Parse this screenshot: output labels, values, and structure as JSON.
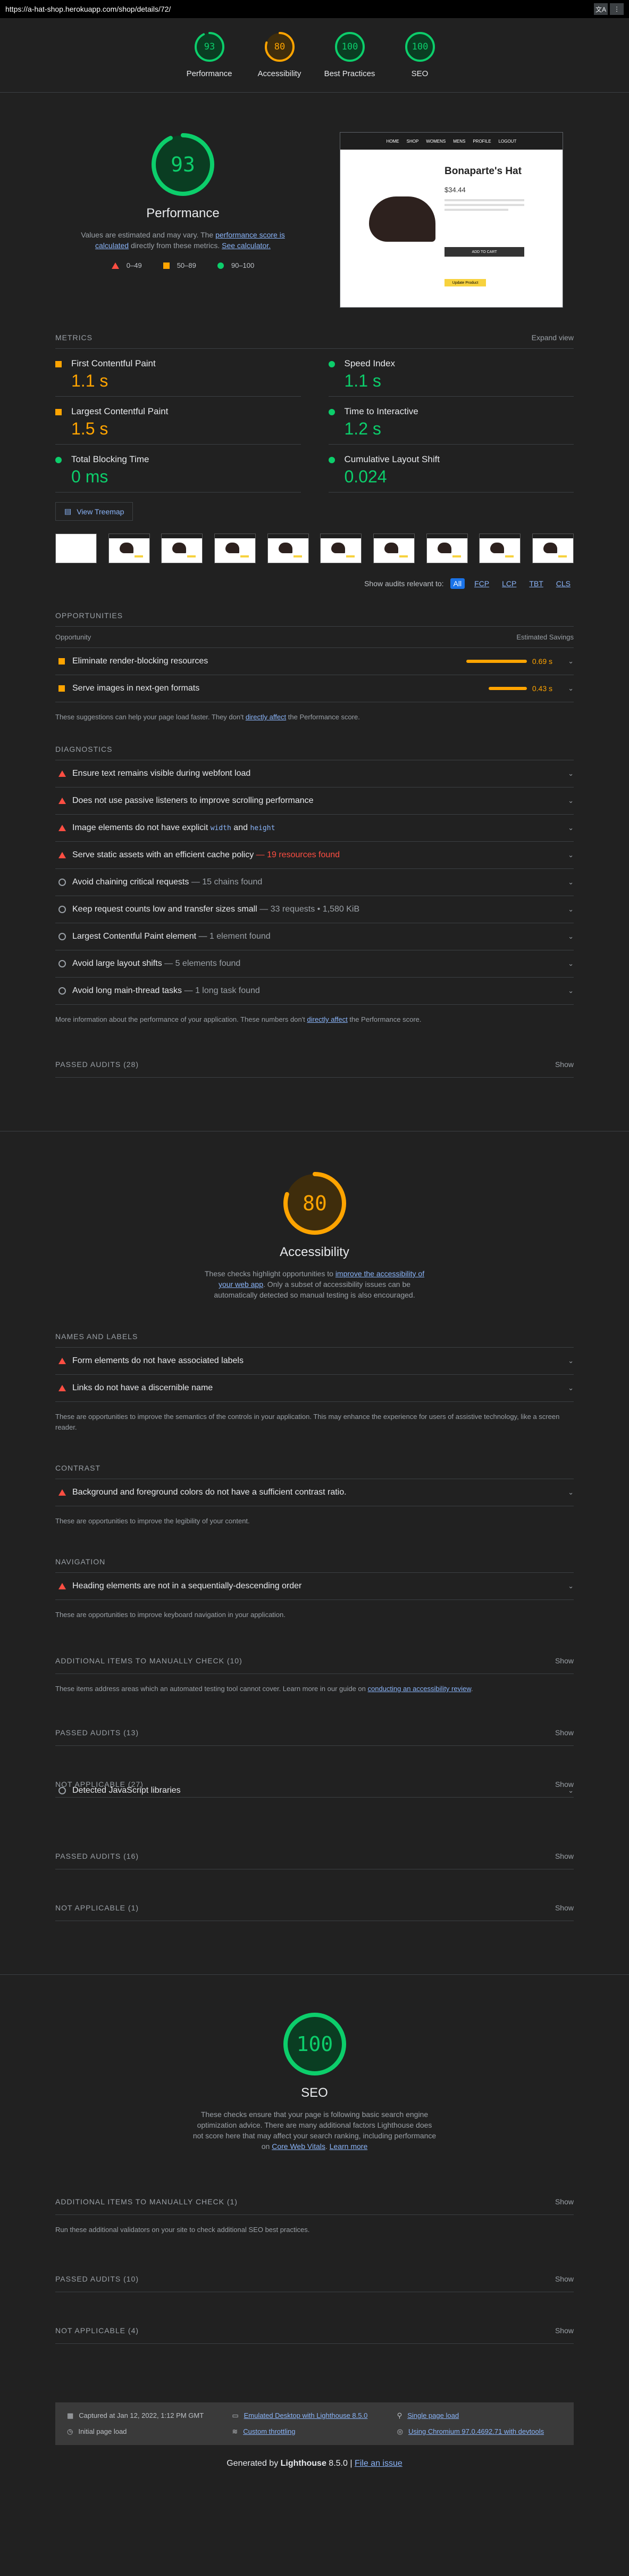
{
  "topbar": {
    "url": "https://a-hat-shop.herokuapp.com/shop/details/72/",
    "translate_icon": "translate-icon",
    "menu_icon": "kebab-icon"
  },
  "summary_gauges": [
    {
      "score": "93",
      "label": "Performance",
      "color": "#0cce6b",
      "value": 93
    },
    {
      "score": "80",
      "label": "Accessibility",
      "color": "#ffa400",
      "value": 80
    },
    {
      "score": "100",
      "label": "Best Practices",
      "color": "#0cce6b",
      "value": 100
    },
    {
      "score": "100",
      "label": "SEO",
      "color": "#0cce6b",
      "value": 100
    }
  ],
  "performance": {
    "score": "93",
    "value": 93,
    "title": "Performance",
    "desc_pre": "Values are estimated and may vary. The ",
    "desc_link1": "performance score is calculated",
    "desc_mid": " directly from these metrics. ",
    "desc_link2": "See calculator.",
    "legend": [
      "0–49",
      "50–89",
      "90–100"
    ],
    "screenshot": {
      "nav_items": [
        "HOME",
        "SHOP",
        "WOMENS",
        "MENS",
        "PROFILE",
        "LOGOUT"
      ],
      "product_title": "Bonaparte's Hat",
      "price": "$34.44",
      "cta": "ADD TO CART",
      "badge": "Update Product"
    },
    "metrics_label": "METRICS",
    "expand_label": "Expand view",
    "metrics": [
      {
        "name": "First Contentful Paint",
        "value": "1.1 s",
        "status": "orange"
      },
      {
        "name": "Speed Index",
        "value": "1.1 s",
        "status": "green"
      },
      {
        "name": "Largest Contentful Paint",
        "value": "1.5 s",
        "status": "orange"
      },
      {
        "name": "Time to Interactive",
        "value": "1.2 s",
        "status": "green"
      },
      {
        "name": "Total Blocking Time",
        "value": "0 ms",
        "status": "green"
      },
      {
        "name": "Cumulative Layout Shift",
        "value": "0.024",
        "status": "green"
      }
    ],
    "treemap_label": "View Treemap",
    "filter_label": "Show audits relevant to:",
    "filters": [
      "All",
      "FCP",
      "LCP",
      "TBT",
      "CLS"
    ],
    "opportunities_title": "OPPORTUNITIES",
    "opp_col1": "Opportunity",
    "opp_col2": "Estimated Savings",
    "opportunities": [
      {
        "title": "Eliminate render-blocking resources",
        "savings": "0.69 s",
        "fraction": 0.95
      },
      {
        "title": "Serve images in next-gen formats",
        "savings": "0.43 s",
        "fraction": 0.6
      }
    ],
    "opp_note_pre": "These suggestions can help your page load faster. They don't ",
    "opp_note_link": "directly affect",
    "opp_note_post": " the Performance score.",
    "diagnostics_title": "DIAGNOSTICS",
    "diagnostics": [
      {
        "title": "Ensure text remains visible during webfont load",
        "sub": "",
        "icon": "fail"
      },
      {
        "title": "Does not use passive listeners to improve scrolling performance",
        "sub": "",
        "icon": "fail"
      },
      {
        "title": "Image elements do not have explicit ",
        "code1": "width",
        "and": " and ",
        "code2": "height",
        "sub": "",
        "icon": "fail"
      },
      {
        "title": "Serve static assets with an efficient cache policy",
        "sub": " — 19 resources found",
        "icon": "fail",
        "sub_red": true
      },
      {
        "title": "Avoid chaining critical requests",
        "sub": " — 15 chains found",
        "icon": "info"
      },
      {
        "title": "Keep request counts low and transfer sizes small",
        "sub": " — 33 requests • 1,580 KiB",
        "icon": "info"
      },
      {
        "title": "Largest Contentful Paint element",
        "sub": " — 1 element found",
        "icon": "info"
      },
      {
        "title": "Avoid large layout shifts",
        "sub": " — 5 elements found",
        "icon": "info"
      },
      {
        "title": "Avoid long main-thread tasks",
        "sub": " — 1 long task found",
        "icon": "info"
      }
    ],
    "diag_note_pre": "More information about the performance of your application. These numbers don't ",
    "diag_note_link": "directly affect",
    "diag_note_post": " the Performance score.",
    "passed": "PASSED AUDITS (28)",
    "show": "Show"
  },
  "accessibility": {
    "score": "80",
    "value": 80,
    "title": "Accessibility",
    "desc_pre": "These checks highlight opportunities to ",
    "desc_link": "improve the accessibility of your web app",
    "desc_post": ". Only a subset of accessibility issues can be automatically detected so manual testing is also encouraged.",
    "groups": [
      {
        "title": "NAMES AND LABELS",
        "audits": [
          "Form elements do not have associated labels",
          "Links do not have a discernible name"
        ],
        "note": "These are opportunities to improve the semantics of the controls in your application. This may enhance the experience for users of assistive technology, like a screen reader."
      },
      {
        "title": "CONTRAST",
        "audits": [
          "Background and foreground colors do not have a sufficient contrast ratio."
        ],
        "note": "These are opportunities to improve the legibility of your content."
      },
      {
        "title": "NAVIGATION",
        "audits": [
          "Heading elements are not in a sequentially-descending order"
        ],
        "note": "These are opportunities to improve keyboard navigation in your application."
      }
    ],
    "manual": "ADDITIONAL ITEMS TO MANUALLY CHECK (10)",
    "manual_note_pre": "These items address areas which an automated testing tool cannot cover. Learn more in our guide on ",
    "manual_note_link": "conducting an accessibility review",
    "manual_note_post": ".",
    "passed": "PASSED AUDITS (13)",
    "not_applicable": "NOT APPLICABLE (27)",
    "show": "Show"
  },
  "best_practices": {
    "detected_js": "Detected JavaScript libraries",
    "passed": "PASSED AUDITS (16)",
    "not_applicable": "NOT APPLICABLE (1)",
    "show": "Show"
  },
  "seo": {
    "score": "100",
    "value": 100,
    "title": "SEO",
    "desc": "These checks ensure that your page is following basic search engine optimization advice. There are many additional factors Lighthouse does not score here that may affect your search ranking, including performance on ",
    "desc_link1": "Core Web Vitals",
    "desc_link2": "Learn more",
    "manual": "ADDITIONAL ITEMS TO MANUALLY CHECK (1)",
    "manual_note": "Run these additional validators on your site to check additional SEO best practices.",
    "passed": "PASSED AUDITS (10)",
    "not_applicable": "NOT APPLICABLE (4)",
    "show": "Show"
  },
  "footer": {
    "captured": "Captured at Jan 12, 2022, 1:12 PM GMT",
    "initial": "Initial page load",
    "emulated": "Emulated Desktop with Lighthouse 8.5.0",
    "throttling": "Custom throttling",
    "single": "Single page load",
    "chromium": "Using Chromium 97.0.4692.71 with devtools",
    "generated_pre": "Generated by ",
    "generated_brand": "Lighthouse",
    "generated_ver": " 8.5.0 | ",
    "file_issue": "File an issue"
  }
}
